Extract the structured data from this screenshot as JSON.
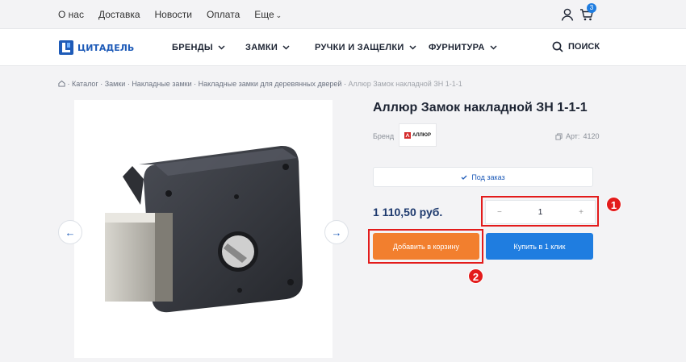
{
  "topbar": {
    "links": [
      "О нас",
      "Доставка",
      "Новости",
      "Оплата",
      "Еще"
    ],
    "cart_count": "3"
  },
  "header": {
    "logo_text": "ЦИТАДЕЛЬ",
    "nav": [
      "БРЕНДЫ",
      "ЗАМКИ",
      "РУЧКИ И ЗАЩЕЛКИ",
      "ФУРНИТУРА"
    ],
    "search_label": "ПОИСК"
  },
  "breadcrumbs": [
    "Каталог",
    "Замки",
    "Накладные замки",
    "Накладные замки для деревянных дверей",
    "Аллюр Замок накладной ЗН 1-1-1"
  ],
  "product": {
    "title": "Аллюр Замок накладной ЗН 1-1-1",
    "brand_label": "Бренд",
    "brand_logo_text": "АЛЛЮР",
    "article_label": "Арт:",
    "article_value": "4120",
    "availability": "Под заказ",
    "price": "1 110,50 руб.",
    "quantity": "1",
    "minus": "−",
    "plus": "+",
    "add_to_cart": "Добавить в корзину",
    "buy_one_click": "Купить в 1 клик"
  },
  "annotations": [
    "1",
    "2"
  ],
  "colors": {
    "accent_blue": "#1f7de0",
    "brand_blue": "#1e5bb8",
    "cart_orange": "#f27f2e",
    "annotation_red": "#e31b1b"
  }
}
